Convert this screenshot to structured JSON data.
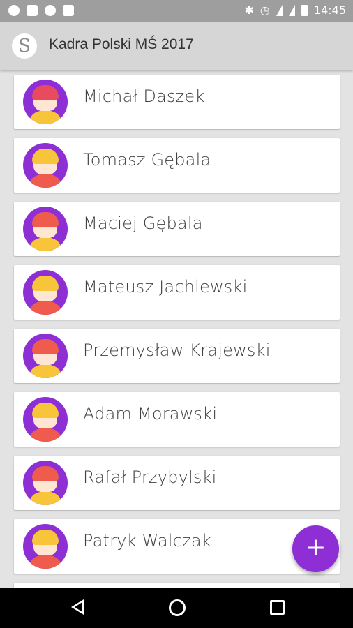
{
  "status_bar": {
    "time": "14:45",
    "left_icons": [
      "spotify-icon",
      "gmail-icon",
      "messenger-icon",
      "image-icon"
    ],
    "right_icons": [
      "bluetooth-icon",
      "alarm-icon",
      "wifi-icon",
      "signal-icon",
      "battery-icon"
    ]
  },
  "app_bar": {
    "logo_letter": "S",
    "title": "Kadra Polski MŚ 2017"
  },
  "players": [
    {
      "name": "Michał Daszek",
      "hair": "#e84a5f",
      "shirt": "#f7c43a"
    },
    {
      "name": "Tomasz Gębala",
      "hair": "#f7c43a",
      "shirt": "#ef5b4d"
    },
    {
      "name": "Maciej Gębala",
      "hair": "#ef5b4d",
      "shirt": "#f7c43a"
    },
    {
      "name": "Mateusz Jachlewski",
      "hair": "#f7c43a",
      "shirt": "#ef5b4d"
    },
    {
      "name": "Przemysław Krajewski",
      "hair": "#ef5b4d",
      "shirt": "#f7c43a"
    },
    {
      "name": "Adam Morawski",
      "hair": "#f7c43a",
      "shirt": "#ef5b4d"
    },
    {
      "name": "Rafał Przybylski",
      "hair": "#ef5b4d",
      "shirt": "#f7c43a"
    },
    {
      "name": "Patryk Walczak",
      "hair": "#f7c43a",
      "shirt": "#ef5b4d"
    }
  ],
  "fab_label": "+",
  "colors": {
    "accent": "#8e2fd6",
    "app_bar": "#d6d6d6",
    "background": "#e3e3e3"
  },
  "nav": {
    "back_icon": "back-icon",
    "home_icon": "home-icon",
    "recents_icon": "recents-icon"
  }
}
